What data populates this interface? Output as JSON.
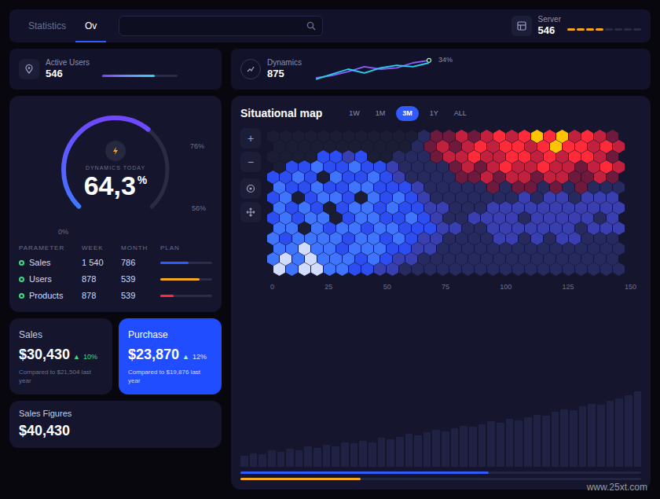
{
  "header": {
    "tabs": [
      {
        "label": "Statistics",
        "selected": false
      },
      {
        "label": "Ov",
        "selected": true
      }
    ],
    "server": {
      "label": "Server",
      "value": "546",
      "level": 0.5
    }
  },
  "active_users": {
    "label": "Active Users",
    "value": "546",
    "level": 0.7
  },
  "dynamics": {
    "label": "Dynamics",
    "value": "875",
    "peak": "34%",
    "series": [
      {
        "color": "#8b5cf6",
        "values": [
          6,
          10,
          16,
          24,
          20,
          22,
          30,
          34
        ]
      },
      {
        "color": "#22d3ee",
        "values": [
          4,
          12,
          20,
          14,
          22,
          26,
          24,
          30
        ]
      }
    ]
  },
  "gauge": {
    "label": "DYNAMICS TODAY",
    "value": "64,3",
    "unit": "%",
    "level": 0.643,
    "ticks": {
      "start": "0%",
      "mid": "56%",
      "high": "76%"
    }
  },
  "table": {
    "columns": [
      "PARAMETER",
      "WEEK",
      "MONTH",
      "PLAN"
    ],
    "rows": [
      {
        "cells": [
          "Sales",
          "1 540",
          "786"
        ],
        "plan_level": 0.55,
        "color": "#2f5bff"
      },
      {
        "cells": [
          "Users",
          "878",
          "539"
        ],
        "plan_level": 0.75,
        "color": "#f5a623"
      },
      {
        "cells": [
          "Products",
          "878",
          "539"
        ],
        "plan_level": 0.25,
        "color": "#ff2b3b"
      }
    ]
  },
  "sales": {
    "title": "Sales",
    "amount": "$30,430",
    "arrow": "▲",
    "change": "10%",
    "note": "Compared to $21,504 last year"
  },
  "purchase": {
    "title": "Purchase",
    "amount": "$23,870",
    "arrow": "▲",
    "change": "12%",
    "note": "Compared to $19,876 last year"
  },
  "sales_figures": {
    "title": "Sales Figures",
    "amount": "$40,430"
  },
  "map": {
    "title": "Situational map",
    "ranges": [
      {
        "label": "1W",
        "selected": false
      },
      {
        "label": "1M",
        "selected": false
      },
      {
        "label": "3M",
        "selected": true
      },
      {
        "label": "1Y",
        "selected": false
      },
      {
        "label": "ALL",
        "selected": false
      }
    ],
    "controls": [
      "+",
      "−"
    ],
    "x_ticks": [
      "0",
      "25",
      "50",
      "75",
      "100",
      "125",
      "150"
    ],
    "cells": [
      [
        0,
        0,
        0,
        0,
        0,
        0,
        0,
        0,
        0,
        0,
        0,
        0,
        1,
        6,
        6,
        7,
        6,
        7,
        8,
        7,
        8,
        9,
        8,
        9,
        7,
        8,
        7,
        6
      ],
      [
        0,
        0,
        0,
        0,
        0,
        0,
        0,
        0,
        0,
        0,
        0,
        1,
        6,
        7,
        6,
        7,
        8,
        7,
        8,
        8,
        7,
        8,
        9,
        8,
        8,
        7,
        8,
        7
      ],
      [
        0,
        0,
        0,
        0,
        3,
        3,
        2,
        3,
        0,
        0,
        1,
        1,
        1,
        6,
        7,
        7,
        8,
        7,
        7,
        8,
        8,
        7,
        8,
        7,
        8,
        8,
        7,
        6
      ],
      [
        0,
        3,
        3,
        4,
        3,
        3,
        4,
        3,
        3,
        2,
        1,
        1,
        1,
        1,
        6,
        7,
        6,
        7,
        8,
        7,
        7,
        8,
        7,
        7,
        6,
        7,
        8,
        7
      ],
      [
        3,
        3,
        4,
        3,
        0,
        4,
        3,
        3,
        4,
        3,
        2,
        1,
        1,
        1,
        1,
        6,
        6,
        7,
        6,
        7,
        7,
        6,
        7,
        7,
        6,
        6,
        7,
        6
      ],
      [
        4,
        3,
        3,
        4,
        3,
        3,
        4,
        4,
        3,
        3,
        3,
        2,
        1,
        1,
        1,
        1,
        1,
        6,
        1,
        6,
        6,
        1,
        6,
        1,
        6,
        1,
        1,
        1
      ],
      [
        3,
        4,
        0,
        3,
        4,
        4,
        3,
        0,
        4,
        3,
        4,
        3,
        2,
        1,
        1,
        1,
        1,
        1,
        1,
        1,
        2,
        1,
        2,
        2,
        1,
        2,
        2,
        2
      ],
      [
        4,
        3,
        4,
        3,
        0,
        3,
        4,
        4,
        3,
        4,
        3,
        3,
        2,
        2,
        1,
        1,
        1,
        2,
        2,
        2,
        2,
        2,
        2,
        2,
        2,
        2,
        2,
        2
      ],
      [
        3,
        4,
        3,
        4,
        4,
        0,
        3,
        4,
        4,
        3,
        3,
        4,
        3,
        2,
        1,
        1,
        2,
        2,
        2,
        2,
        1,
        2,
        2,
        2,
        2,
        2,
        1,
        2
      ],
      [
        4,
        4,
        0,
        4,
        3,
        4,
        4,
        3,
        4,
        4,
        3,
        3,
        3,
        2,
        2,
        1,
        1,
        2,
        2,
        2,
        2,
        2,
        2,
        2,
        1,
        2,
        2,
        2
      ],
      [
        4,
        3,
        4,
        4,
        4,
        4,
        3,
        4,
        4,
        3,
        4,
        3,
        2,
        2,
        1,
        1,
        1,
        1,
        2,
        2,
        1,
        2,
        1,
        2,
        2,
        1,
        1,
        1
      ],
      [
        4,
        4,
        5,
        4,
        4,
        3,
        4,
        4,
        4,
        3,
        3,
        2,
        2,
        1,
        1,
        1,
        1,
        1,
        1,
        1,
        1,
        1,
        1,
        1,
        1,
        1,
        1,
        1
      ],
      [
        4,
        5,
        4,
        5,
        4,
        4,
        4,
        3,
        4,
        3,
        2,
        2,
        1,
        1,
        1,
        1,
        1,
        1,
        1,
        1,
        1,
        1,
        1,
        1,
        1,
        1,
        1,
        1
      ],
      [
        5,
        4,
        5,
        5,
        4,
        4,
        3,
        3,
        2,
        2,
        1,
        1,
        1,
        1,
        1,
        1,
        1,
        1,
        1,
        1,
        1,
        1,
        1,
        1,
        1,
        1,
        1,
        1
      ]
    ],
    "volume": [
      8,
      10,
      9,
      12,
      11,
      13,
      12,
      15,
      14,
      16,
      15,
      18,
      17,
      19,
      18,
      21,
      20,
      22,
      24,
      23,
      25,
      27,
      26,
      28,
      30,
      29,
      31,
      33,
      32,
      35,
      34,
      36,
      38,
      37,
      40,
      42,
      41,
      44,
      46,
      45,
      48,
      50,
      52,
      55
    ],
    "progress": [
      {
        "color": "#2f5bff",
        "level": 0.62
      },
      {
        "color": "#f5a623",
        "level": 0.3
      }
    ]
  },
  "watermark": "www.25xt.com"
}
